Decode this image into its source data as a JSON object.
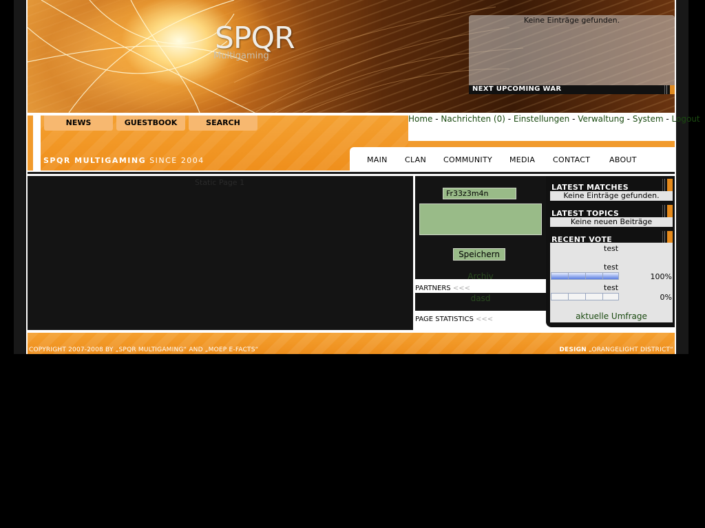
{
  "header": {
    "logo_title": "SPQR",
    "logo_subtitle": "Multigaming",
    "war_box_empty": "Keine Einträge gefunden.",
    "war_bar_label": "NEXT UPCOMING WAR"
  },
  "nav_buttons": [
    "NEWS",
    "GUESTBOOK",
    "SEARCH"
  ],
  "since": {
    "brand": "SPQR MULTIGAMING",
    "suffix": " SINCE 2004"
  },
  "userbar": {
    "links": [
      "Home",
      "Nachrichten (0)",
      "Einstellungen",
      "Verwaltung",
      "System",
      "Logout"
    ],
    "separator": " - "
  },
  "menu": [
    "MAIN",
    "CLAN",
    "COMMUNITY",
    "MEDIA",
    "CONTACT",
    "ABOUT"
  ],
  "main": {
    "static_title": "Static Page 1"
  },
  "shoutbox": {
    "nick_value": "Fr33z3m4n",
    "save_label": "Speichern",
    "archive_link": "Archiv"
  },
  "partners": {
    "label": "PARTNERS",
    "arrows": "<<<",
    "item": "dasd"
  },
  "stats": {
    "label": "PAGE STATISTICS",
    "arrows": "<<<"
  },
  "sidebar": {
    "latest_matches": {
      "title": "LATEST MATCHES",
      "empty": "Keine Einträge gefunden."
    },
    "latest_topics": {
      "title": "LATEST TOPICS",
      "empty": "Keine neuen Beiträge"
    },
    "recent_vote": {
      "title": "RECENT VOTE",
      "question": "test",
      "options": [
        {
          "label": "test",
          "percent_text": "100%",
          "fraction": 1.0
        },
        {
          "label": "test",
          "percent_text": "0%",
          "fraction": 0.0
        }
      ],
      "link": "aktuelle Umfrage"
    }
  },
  "footer": {
    "copyright": "COPYRIGHT 2007-2008 BY „SPQR MULTIGAMING“ AND „MOEP E-FACTS“",
    "design_label": "DESIGN",
    "design_value": " „ORANGELIGHT DISTRICT“"
  },
  "colors": {
    "accent": "#f19a2c",
    "field_green": "#99bb88",
    "dark_bg": "#141414",
    "link_green": "#1a4a10"
  }
}
